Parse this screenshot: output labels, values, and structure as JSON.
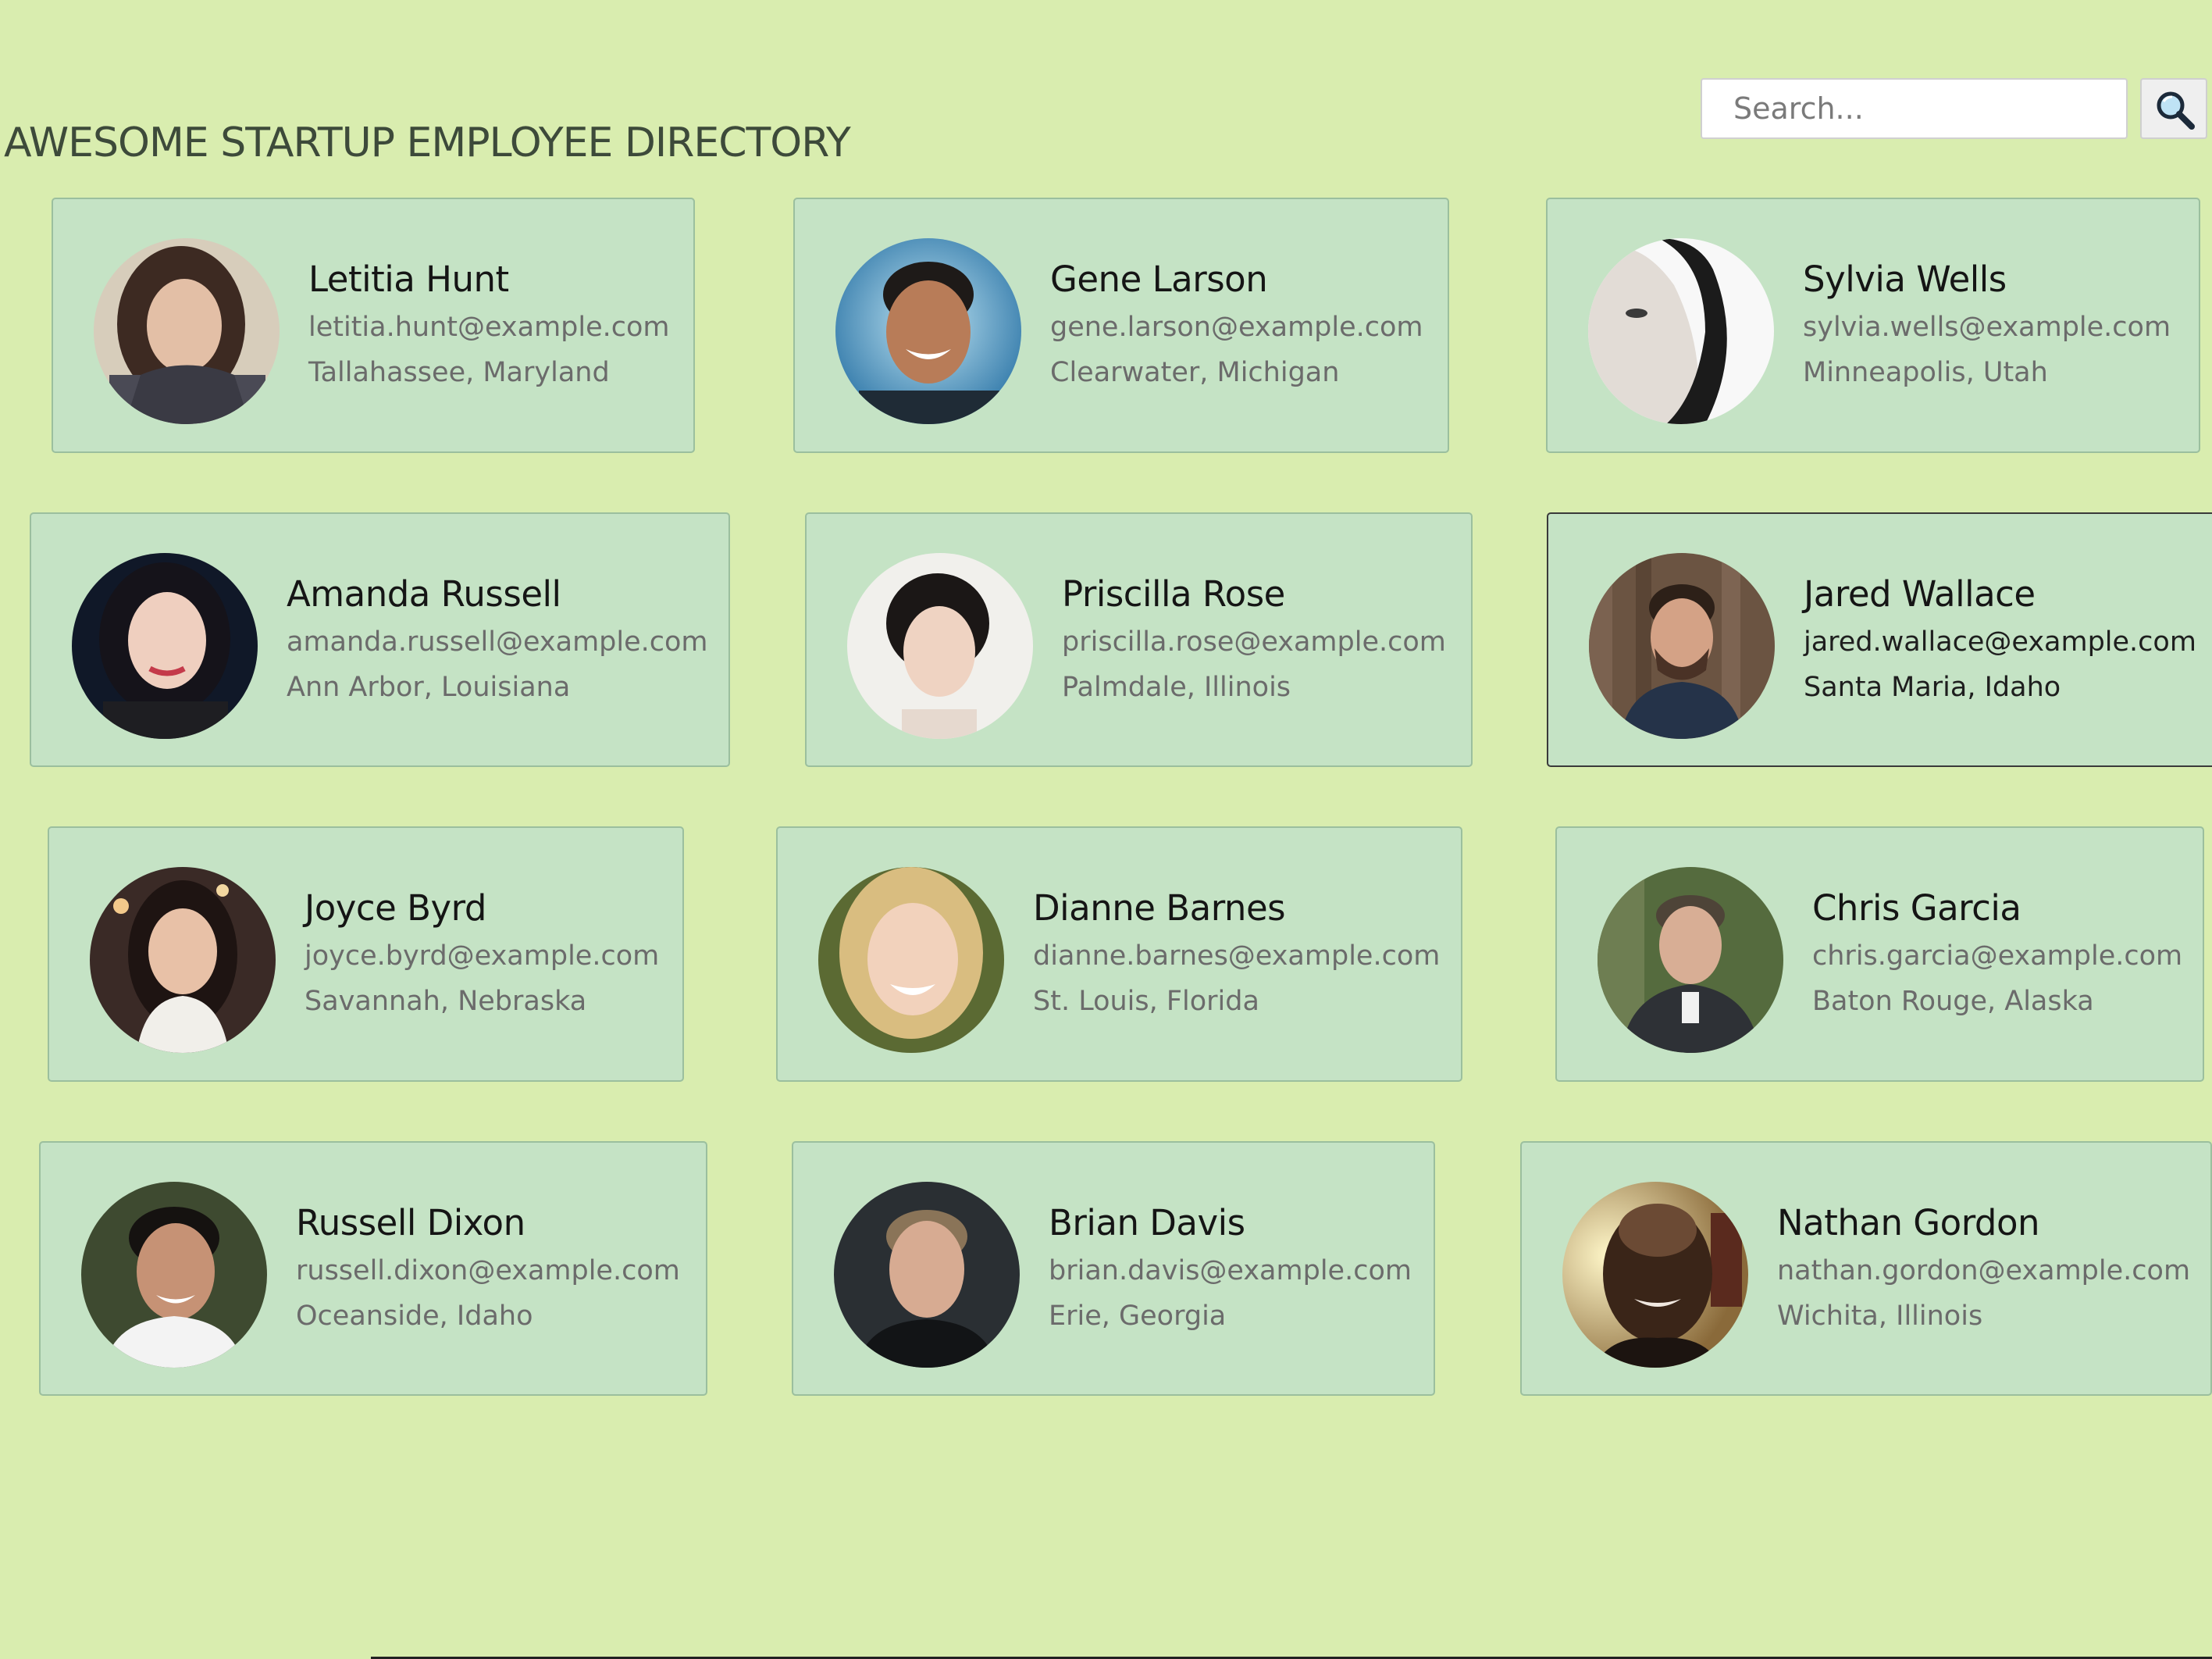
{
  "header": {
    "title": "AWESOME STARTUP EMPLOYEE DIRECTORY"
  },
  "search": {
    "placeholder": "Search...",
    "button_icon": "magnifying-glass-icon"
  },
  "colors": {
    "page_background": "#d9edaf",
    "card_background": "#c5e3c5",
    "card_border": "#9bbf9e",
    "active_card_border": "#3a3a3a"
  },
  "employees": [
    {
      "name": "Letitia Hunt",
      "email": "letitia.hunt@example.com",
      "location": "Tallahassee, Maryland"
    },
    {
      "name": "Gene Larson",
      "email": "gene.larson@example.com",
      "location": "Clearwater, Michigan"
    },
    {
      "name": "Sylvia Wells",
      "email": "sylvia.wells@example.com",
      "location": "Minneapolis, Utah"
    },
    {
      "name": "Amanda Russell",
      "email": "amanda.russell@example.com",
      "location": "Ann Arbor, Louisiana"
    },
    {
      "name": "Priscilla Rose",
      "email": "priscilla.rose@example.com",
      "location": "Palmdale, Illinois"
    },
    {
      "name": "Jared Wallace",
      "email": "jared.wallace@example.com",
      "location": "Santa Maria, Idaho",
      "hovered": true
    },
    {
      "name": "Joyce Byrd",
      "email": "joyce.byrd@example.com",
      "location": "Savannah, Nebraska"
    },
    {
      "name": "Dianne Barnes",
      "email": "dianne.barnes@example.com",
      "location": "St. Louis, Florida"
    },
    {
      "name": "Chris Garcia",
      "email": "chris.garcia@example.com",
      "location": "Baton Rouge, Alaska"
    },
    {
      "name": "Russell Dixon",
      "email": "russell.dixon@example.com",
      "location": "Oceanside, Idaho"
    },
    {
      "name": "Brian Davis",
      "email": "brian.davis@example.com",
      "location": "Erie, Georgia"
    },
    {
      "name": "Nathan Gordon",
      "email": "nathan.gordon@example.com",
      "location": "Wichita, Illinois"
    }
  ]
}
